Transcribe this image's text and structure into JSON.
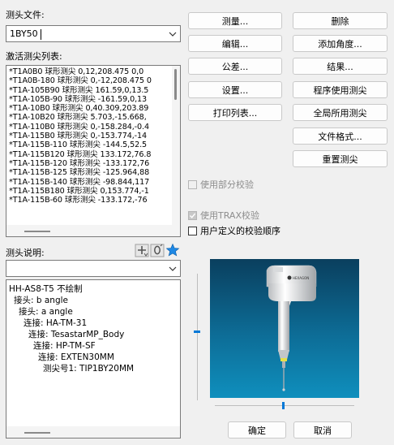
{
  "probe_file": {
    "label": "测头文件:",
    "value": "1BY50"
  },
  "active_probes": {
    "label": "激活测尖列表:",
    "rows": [
      "*T1A0B0  球形测尖  0,12,208.475  0,0",
      "*T1A0B-180 球形测尖 0,-12,208.475 0",
      "*T1A-105B90 球形测尖  161.59,0,13.5",
      "*T1A-105B-90 球形测尖  -161.59,0,13",
      "*T1A-10B0  球形测尖  0,40.309,203.89",
      "*T1A-10B20 球形测尖  5.703,-15.668,",
      "*T1A-110B0 球形测尖  0,-158.284,-0.4",
      "*T1A-115B0 球形测尖  0,-153.774,-14",
      "*T1A-115B-110 球形测尖  -144.5,52.5",
      "*T1A-115B120 球形测尖  133.172,76.8",
      "*T1A-115B-120 球形测尖  -133.172,76",
      "*T1A-115B-125 球形测尖  -125.964,88",
      "*T1A-115B-140 球形测尖  -98.844,117",
      "*T1A-115B180 球形测尖  0,153.774,-1",
      "*T1A-115B-60 球形测尖  -133.172,-76"
    ]
  },
  "buttons": {
    "measure": "测量...",
    "delete": "删除",
    "edit": "编辑...",
    "add_angle": "添加角度...",
    "tolerance": "公差...",
    "results": "结果...",
    "settings": "设置...",
    "program_probes": "程序使用测尖",
    "print_list": "打印列表...",
    "global_probes": "全局所用测尖",
    "file_format": "文件格式...",
    "reset_probes": "重置测尖",
    "ok": "确定",
    "cancel": "取消"
  },
  "checkboxes": {
    "partial_calibration": "使用部分校验",
    "trax_calibration": "使用TRAX校验",
    "user_order": "用户定义的校验顺序"
  },
  "probe_description": {
    "label": "测头说明:",
    "value": "",
    "tree": [
      "HH-AS8-T5  不绘制",
      "接头: b angle",
      "接头: a angle",
      "连接: HA-TM-31",
      "连接: TesastarMP_Body",
      "连接: HP-TM-SF",
      "连接: EXTEN30MM",
      "测尖号1: TIP1BY20MM"
    ]
  },
  "preview": {
    "brand_text": "HEXAGON"
  },
  "colors": {
    "preview_top": "#0a3f5e",
    "preview_bottom": "#0f8fbd",
    "accent": "#0078d7",
    "star": "#1e88e5"
  }
}
